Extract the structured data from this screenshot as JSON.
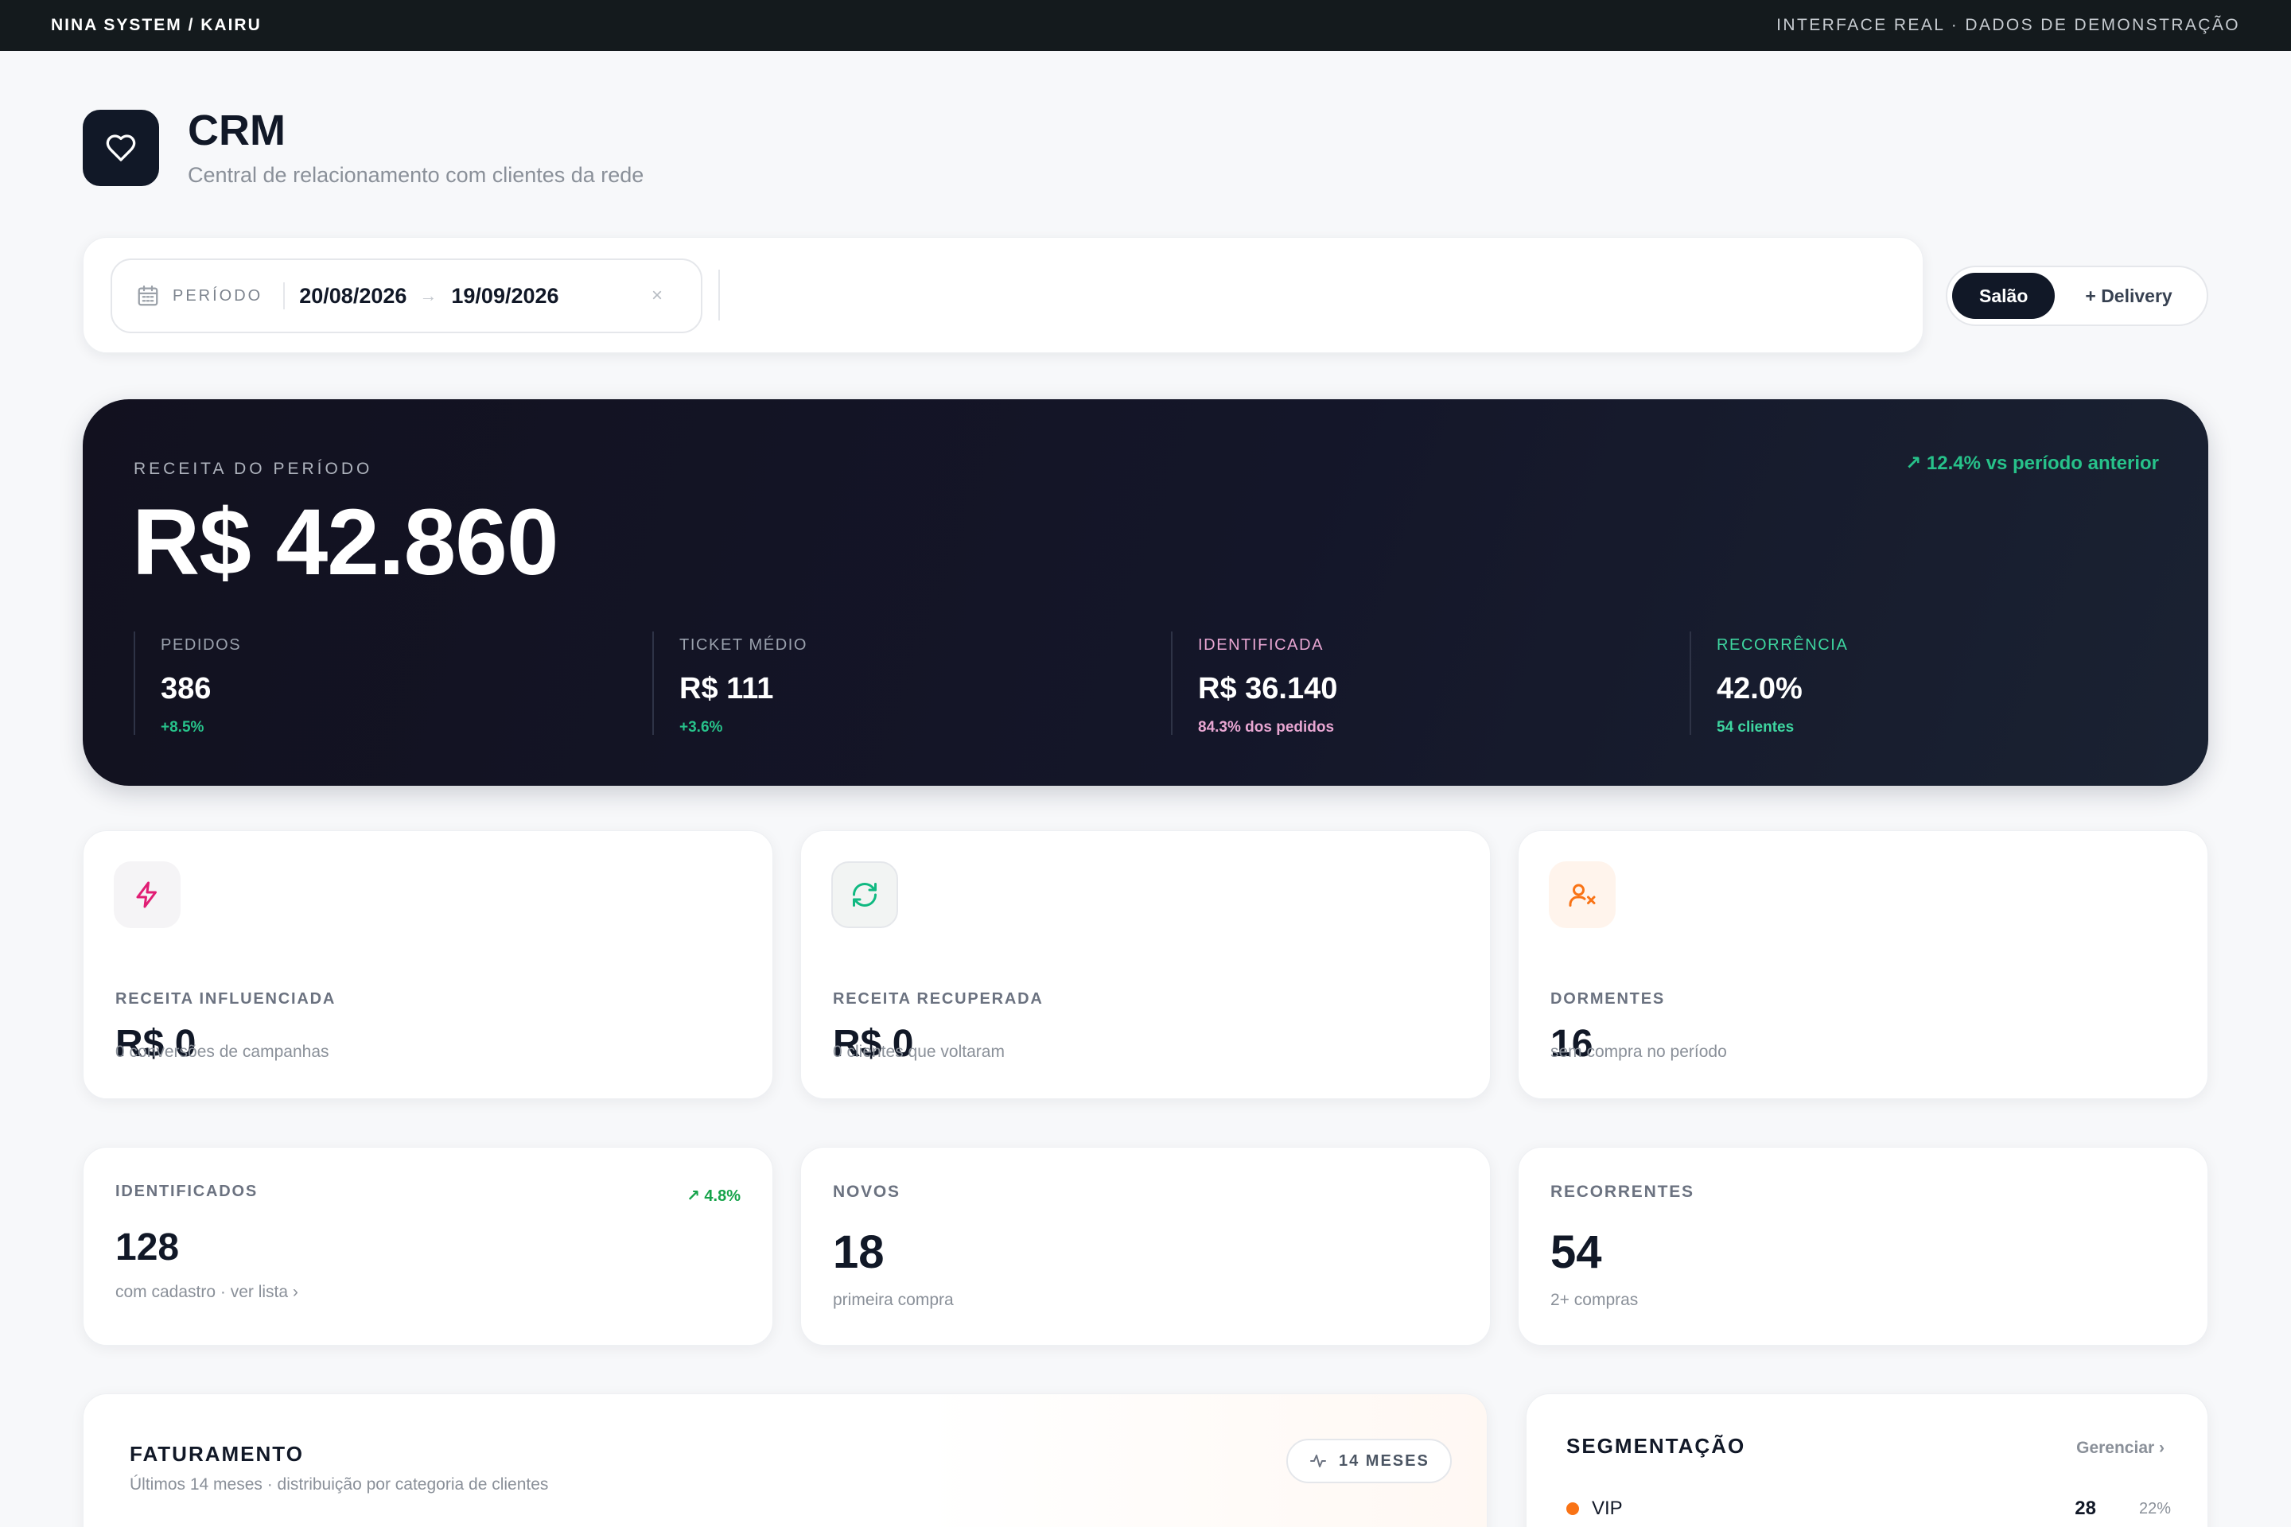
{
  "topbar": {
    "brand": "NINA SYSTEM / KAIRU",
    "note": "INTERFACE REAL · DADOS DE DEMONSTRAÇÃO"
  },
  "header": {
    "title": "CRM",
    "subtitle": "Central de relacionamento com clientes da rede",
    "icon": "heart-icon"
  },
  "filter": {
    "period_label": "PERÍODO",
    "date_start": "20/08/2026",
    "arrow": "→",
    "date_end": "19/09/2026",
    "clear": "×"
  },
  "channel_toggle": {
    "active": "Salão",
    "other": "+ Delivery"
  },
  "hero": {
    "eyebrow": "RECEITA DO PERÍODO",
    "value": "R$ 42.860",
    "delta": "↗  12.4% vs período anterior",
    "stats": [
      {
        "label": "PEDIDOS",
        "value": "386",
        "sub": "+8.5%",
        "color": "#27c28a",
        "label_color": "#9aa1ad"
      },
      {
        "label": "TICKET MÉDIO",
        "value": "R$ 111",
        "sub": "+3.6%",
        "color": "#27c28a",
        "label_color": "#9aa1ad"
      },
      {
        "label": "IDENTIFICADA",
        "value": "R$ 36.140",
        "sub": "84.3% dos pedidos",
        "color": "#e8a6d2",
        "label_color": "#e8a6d2"
      },
      {
        "label": "RECORRÊNCIA",
        "value": "42.0%",
        "sub": "54 clientes",
        "color": "#3ed6a0",
        "label_color": "#3ed6a0"
      }
    ]
  },
  "metrics_row1": [
    {
      "icon": "lightning-icon",
      "label": "RECEITA INFLUENCIADA",
      "value": "R$ 0",
      "sub": "0 conversões de campanhas"
    },
    {
      "icon": "refresh-icon",
      "label": "RECEITA RECUPERADA",
      "value": "R$ 0",
      "sub": "0 clientes que voltaram"
    },
    {
      "icon": "user-x-icon",
      "label": "DORMENTES",
      "value": "16",
      "sub": "sem compra no período"
    }
  ],
  "metrics_row2": [
    {
      "label": "IDENTIFICADOS",
      "value": "128",
      "sub": "com cadastro · ver lista  ›",
      "tag": "↗ 4.8%"
    },
    {
      "label": "NOVOS",
      "value": "18",
      "sub": "primeira compra"
    },
    {
      "label": "RECORRENTES",
      "value": "54",
      "sub": "2+ compras"
    }
  ],
  "faturamento": {
    "title": "FATURAMENTO",
    "sub": "Últimos 14 meses · distribuição por categoria de clientes",
    "pill": "14 MESES"
  },
  "segmentacao": {
    "title": "SEGMENTAÇÃO",
    "manage": "Gerenciar  ›",
    "rows": [
      {
        "name": "VIP",
        "count": "28",
        "pct": "22%",
        "color": "#f97316"
      }
    ]
  }
}
